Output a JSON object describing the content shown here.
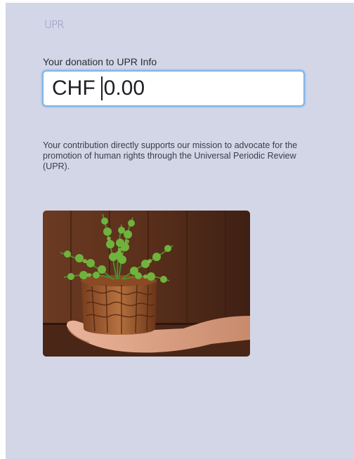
{
  "brand": {
    "logo_text": "UPR"
  },
  "donation": {
    "label": "Your donation to UPR Info",
    "currency": "CHF",
    "amount": "0.00"
  },
  "description": "Your contribution directly supports our mission to advocate for the promotion of human rights through the Universal Periodic Review (UPR).",
  "image": {
    "subject": "hands holding a potted fern"
  },
  "colors": {
    "panel_background": "#d3d6e6",
    "input_focus_border": "#7fb4ea",
    "logo": "#8a90c4"
  }
}
